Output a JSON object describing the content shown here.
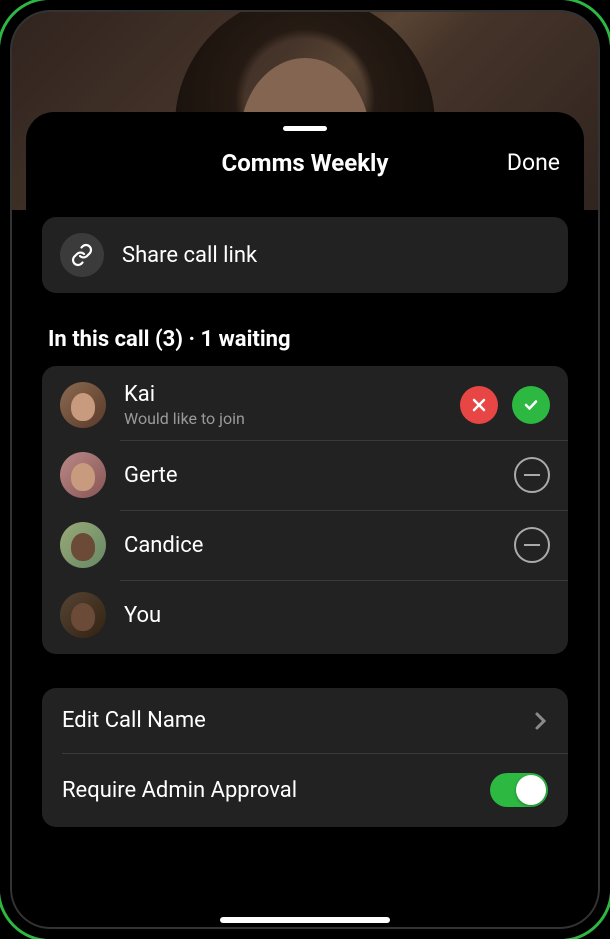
{
  "header": {
    "title": "Comms Weekly",
    "done": "Done"
  },
  "share": {
    "label": "Share call link"
  },
  "section_label": "In this call (3) · 1 waiting",
  "participants": [
    {
      "name": "Kai",
      "sub": "Would like to join"
    },
    {
      "name": "Gerte"
    },
    {
      "name": "Candice"
    },
    {
      "name": "You"
    }
  ],
  "settings": {
    "edit_name": "Edit Call Name",
    "admin_approval": "Require Admin Approval"
  }
}
